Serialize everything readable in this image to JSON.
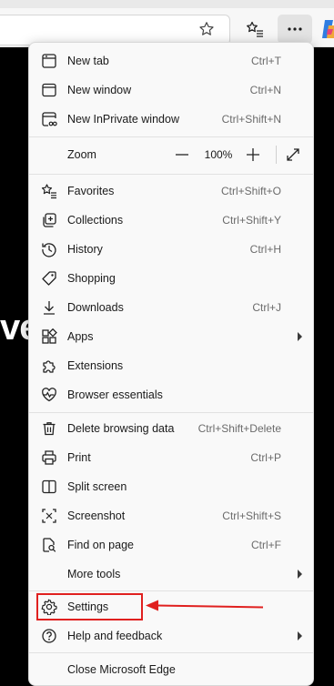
{
  "page_text": "ve",
  "toolbar": {
    "favorite_icon": "star-outline",
    "favorites_icon": "favorites-list",
    "more_icon": "ellipsis",
    "copilot_icon": "copilot"
  },
  "menu": {
    "new_tab": {
      "label": "New tab",
      "shortcut": "Ctrl+T"
    },
    "new_window": {
      "label": "New window",
      "shortcut": "Ctrl+N"
    },
    "new_inprivate": {
      "label": "New InPrivate window",
      "shortcut": "Ctrl+Shift+N"
    },
    "zoom": {
      "label": "Zoom",
      "minus": "—",
      "value": "100%",
      "plus": "+"
    },
    "favorites": {
      "label": "Favorites",
      "shortcut": "Ctrl+Shift+O"
    },
    "collections": {
      "label": "Collections",
      "shortcut": "Ctrl+Shift+Y"
    },
    "history": {
      "label": "History",
      "shortcut": "Ctrl+H"
    },
    "shopping": {
      "label": "Shopping"
    },
    "downloads": {
      "label": "Downloads",
      "shortcut": "Ctrl+J"
    },
    "apps": {
      "label": "Apps"
    },
    "extensions": {
      "label": "Extensions"
    },
    "browser_essentials": {
      "label": "Browser essentials"
    },
    "delete_browsing_data": {
      "label": "Delete browsing data",
      "shortcut": "Ctrl+Shift+Delete"
    },
    "print": {
      "label": "Print",
      "shortcut": "Ctrl+P"
    },
    "split_screen": {
      "label": "Split screen"
    },
    "screenshot": {
      "label": "Screenshot",
      "shortcut": "Ctrl+Shift+S"
    },
    "find_on_page": {
      "label": "Find on page",
      "shortcut": "Ctrl+F"
    },
    "more_tools": {
      "label": "More tools"
    },
    "settings": {
      "label": "Settings"
    },
    "help_feedback": {
      "label": "Help and feedback"
    },
    "close_edge": {
      "label": "Close Microsoft Edge"
    }
  },
  "colors": {
    "highlight": "#e0201f",
    "menu_bg": "#f9f9f9",
    "page_bg": "#000000"
  }
}
